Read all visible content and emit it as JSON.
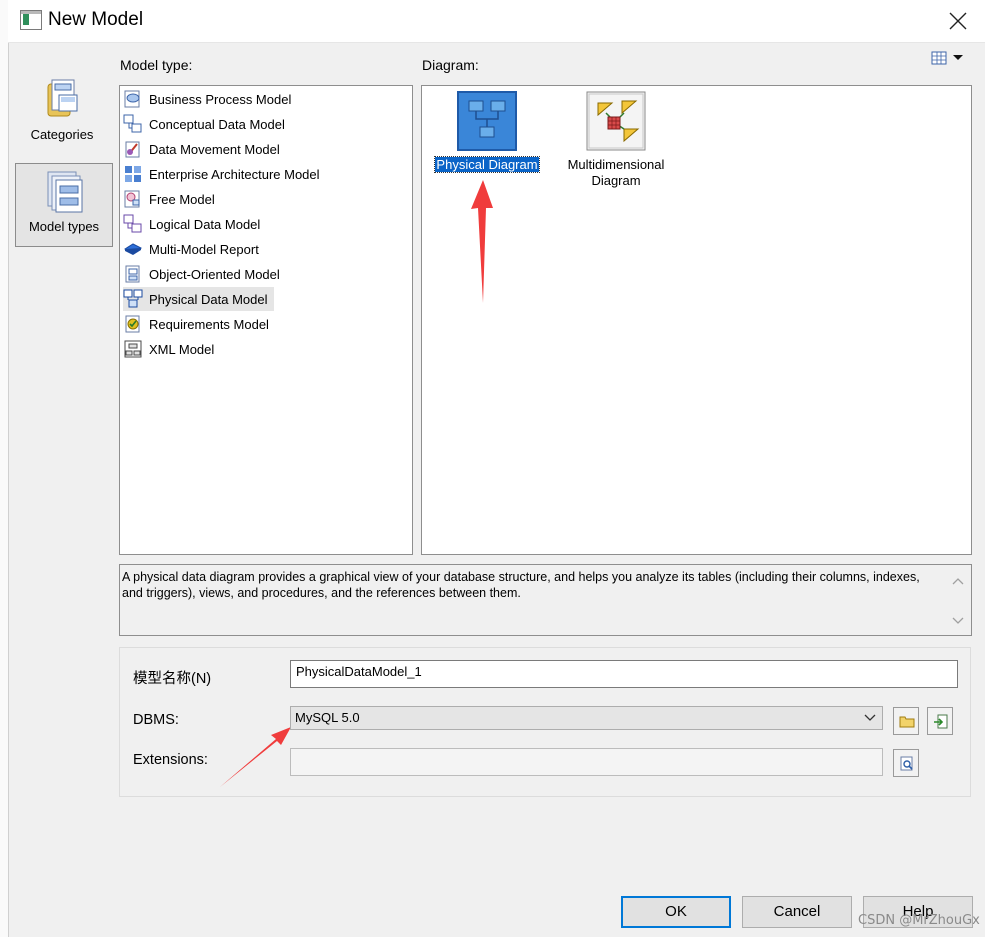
{
  "window": {
    "title": "New Model"
  },
  "categories": [
    {
      "label": "Categories",
      "icon": "categories-icon",
      "selected": false
    },
    {
      "label": "Model types",
      "icon": "model-types-icon",
      "selected": true
    }
  ],
  "model_type": {
    "label": "Model type:",
    "items": [
      {
        "label": "Business Process Model",
        "icon": "business-process-model-icon"
      },
      {
        "label": "Conceptual Data Model",
        "icon": "conceptual-data-model-icon"
      },
      {
        "label": "Data Movement Model",
        "icon": "data-movement-model-icon"
      },
      {
        "label": "Enterprise Architecture Model",
        "icon": "enterprise-architecture-model-icon"
      },
      {
        "label": "Free Model",
        "icon": "free-model-icon"
      },
      {
        "label": "Logical Data Model",
        "icon": "logical-data-model-icon"
      },
      {
        "label": "Multi-Model Report",
        "icon": "multi-model-report-icon"
      },
      {
        "label": "Object-Oriented Model",
        "icon": "object-oriented-model-icon"
      },
      {
        "label": "Physical Data Model",
        "icon": "physical-data-model-icon",
        "selected": true
      },
      {
        "label": "Requirements Model",
        "icon": "requirements-model-icon"
      },
      {
        "label": "XML Model",
        "icon": "xml-model-icon"
      }
    ]
  },
  "diagram": {
    "label": "Diagram:",
    "view_toggle_icon": "view-options-icon",
    "items": [
      {
        "label": "Physical Diagram",
        "icon": "physical-diagram-icon",
        "selected": true
      },
      {
        "label": "Multidimensional Diagram",
        "icon": "multidimensional-diagram-icon",
        "selected": false
      }
    ]
  },
  "description": {
    "text": "A physical data diagram provides a graphical view of your database structure, and helps you analyze its tables (including their columns, indexes, and triggers), views, and procedures, and the references between them."
  },
  "form": {
    "name_label": "模型名称(N)",
    "name_value": "PhysicalDataModel_1",
    "dbms_label": "DBMS:",
    "dbms_value": "MySQL 5.0",
    "extensions_label": "Extensions:",
    "extensions_value": ""
  },
  "buttons": {
    "ok": "OK",
    "cancel": "Cancel",
    "help": "Help"
  },
  "watermark": "CSDN @MrZhouGx",
  "colors": {
    "selection": "#0a64c8",
    "annotation_arrow": "#f03c3c",
    "default_button_border": "#0078d7"
  }
}
